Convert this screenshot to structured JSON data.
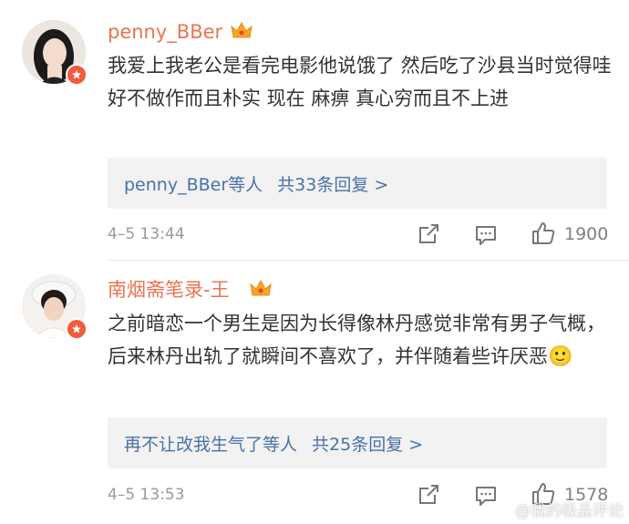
{
  "comments": [
    {
      "username": "penny_BBer",
      "text": "我爱上我老公是看完电影他说饿了 然后吃了沙县当时觉得哇 好不做作而且朴实 现在 麻痹 真心穷而且不上进",
      "reply_users": "penny_BBer等人",
      "reply_count": "共33条回复 >",
      "time": "4–5 13:44",
      "likes": "1900"
    },
    {
      "username": "南烟斋笔录-王",
      "text": "之前暗恋一个男生是因为长得像林丹感觉非常有男子气概，后来林丹出轨了就瞬间不喜欢了，并伴随着些许厌恶",
      "reply_users": "再不让改我生气了等人",
      "reply_count": "共25条回复 >",
      "time": "4–5 13:53",
      "likes": "1578"
    }
  ],
  "emoji": "🙂",
  "watermark": "@我的极品评论",
  "colors": {
    "username": "#eb7350",
    "link": "#4a72a8",
    "badge": "#f25b3c"
  }
}
